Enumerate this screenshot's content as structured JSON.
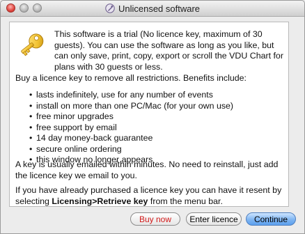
{
  "window": {
    "title": "Unlicensed software"
  },
  "message": {
    "intro": "This software is a trial (No licence key, maximum of 30 guests). You can use the software as long as you like, but can only save, print, copy, export or scroll the VDU Chart for plans with 30 guests or less.",
    "benefits_heading": "Buy a licence key to remove all restrictions. Benefits include:",
    "benefits": [
      "lasts indefinitely, use for any number of events",
      "install on more than one PC/Mac (for your own use)",
      "free minor upgrades",
      "free support by email",
      "14 day money-back guarantee",
      "secure online ordering",
      "this window no longer appears"
    ],
    "email_note": "A key is usually emailed within minutes. No need to reinstall, just add the licence key we email to you.",
    "resend_prefix": "If you have already purchased a licence key you can have it resent by selecting ",
    "resend_menu": "Licensing>Retrieve key",
    "resend_suffix": " from the menu bar."
  },
  "buttons": {
    "buy": "Buy now",
    "enter": "Enter licence",
    "continue": "Continue"
  },
  "icons": {
    "app": "app-icon",
    "key": "key-icon"
  },
  "colors": {
    "buy_text": "#d21a1a",
    "continue_fill": "#7fb5f2",
    "key_gold": "#f2c230"
  }
}
